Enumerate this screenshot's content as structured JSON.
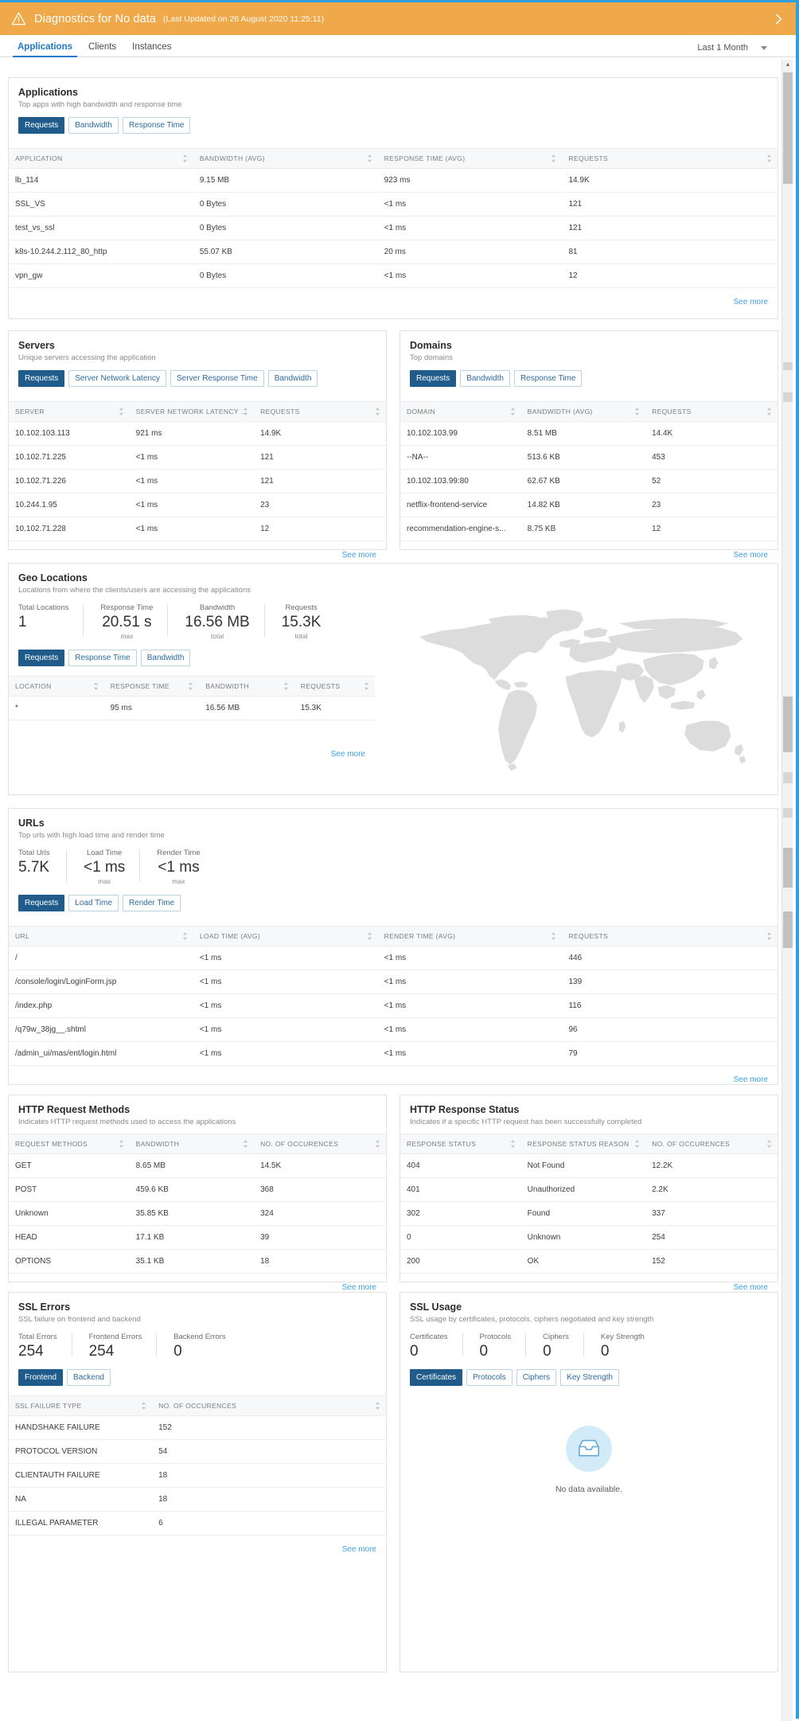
{
  "theme": {
    "banner_bg": "#efa94a",
    "accent_blue": "#2079c6",
    "pill_active_bg": "#1f5c8b",
    "link_blue": "#3da1e5",
    "frame_blue": "#2ca0e0"
  },
  "banner": {
    "icon": "warning-triangle-icon",
    "title": "Diagnostics for No data",
    "subtitle": "(Last Updated on 26 August 2020 11:25:11)",
    "chevron": "chevron-right-icon"
  },
  "tabs": [
    {
      "label": "Applications",
      "active": true
    },
    {
      "label": "Clients",
      "active": false
    },
    {
      "label": "Instances",
      "active": false
    }
  ],
  "time_range": {
    "label": "Last 1 Month",
    "icon": "chevron-down-icon"
  },
  "common": {
    "see_more": "See more"
  },
  "applications": {
    "title": "Applications",
    "subtitle": "Top apps with high bandwidth and response time",
    "pills": [
      "Requests",
      "Bandwidth",
      "Response Time"
    ],
    "active_pill": "Requests",
    "columns": [
      "APPLICATION",
      "BANDWIDTH (AVG)",
      "RESPONSE TIME (AVG)",
      "REQUESTS"
    ],
    "rows": [
      [
        "lb_114",
        "9.15 MB",
        "923 ms",
        "14.9K"
      ],
      [
        "SSL_VS",
        "0 Bytes",
        "<1 ms",
        "121"
      ],
      [
        "test_vs_ssl",
        "0 Bytes",
        "<1 ms",
        "121"
      ],
      [
        "k8s-10.244.2.112_80_http",
        "55.07 KB",
        "20 ms",
        "81"
      ],
      [
        "vpn_gw",
        "0 Bytes",
        "<1 ms",
        "12"
      ]
    ]
  },
  "servers": {
    "title": "Servers",
    "subtitle": "Unique servers accessing the application",
    "pills": [
      "Requests",
      "Server Network Latency",
      "Server Response Time",
      "Bandwidth"
    ],
    "active_pill": "Requests",
    "columns": [
      "SERVER",
      "SERVER NETWORK LATENCY (...",
      "REQUESTS"
    ],
    "rows": [
      [
        "10.102.103.113",
        "921 ms",
        "14.9K"
      ],
      [
        "10.102.71.225",
        "<1 ms",
        "121"
      ],
      [
        "10.102.71.226",
        "<1 ms",
        "121"
      ],
      [
        "10.244.1.95",
        "<1 ms",
        "23"
      ],
      [
        "10.102.71.228",
        "<1 ms",
        "12"
      ]
    ]
  },
  "domains": {
    "title": "Domains",
    "subtitle": "Top domains",
    "pills": [
      "Requests",
      "Bandwidth",
      "Response Time"
    ],
    "active_pill": "Requests",
    "columns": [
      "DOMAIN",
      "BANDWIDTH (AVG)",
      "REQUESTS"
    ],
    "rows": [
      [
        "10.102.103.99",
        "8.51 MB",
        "14.4K"
      ],
      [
        "--NA--",
        "513.6 KB",
        "453"
      ],
      [
        "10.102.103.99:80",
        "62.67 KB",
        "52"
      ],
      [
        "netflix-frontend-service",
        "14.82 KB",
        "23"
      ],
      [
        "recommendation-engine-s...",
        "8.75 KB",
        "12"
      ]
    ]
  },
  "geo": {
    "title": "Geo Locations",
    "subtitle": "Locations from where the clients/users are accessing the applications",
    "kpis": [
      {
        "label": "Total Locations",
        "value": "1",
        "unit": ""
      },
      {
        "label": "Response Time",
        "value": "20.51 s",
        "unit": "max"
      },
      {
        "label": "Bandwidth",
        "value": "16.56 MB",
        "unit": "total"
      },
      {
        "label": "Requests",
        "value": "15.3K",
        "unit": "total"
      }
    ],
    "pills": [
      "Requests",
      "Response Time",
      "Bandwidth"
    ],
    "active_pill": "Requests",
    "columns": [
      "LOCATION",
      "RESPONSE TIME",
      "BANDWIDTH",
      "REQUESTS"
    ],
    "rows": [
      [
        "*",
        "95 ms",
        "16.56 MB",
        "15.3K"
      ]
    ],
    "map_icon": "world-map"
  },
  "urls": {
    "title": "URLs",
    "subtitle": "Top urls with high load time and render time",
    "kpis": [
      {
        "label": "Total Urls",
        "value": "5.7K",
        "unit": ""
      },
      {
        "label": "Load Time",
        "value": "<1 ms",
        "unit": "max"
      },
      {
        "label": "Render Time",
        "value": "<1 ms",
        "unit": "max"
      }
    ],
    "pills": [
      "Requests",
      "Load Time",
      "Render Time"
    ],
    "active_pill": "Requests",
    "columns": [
      "URL",
      "LOAD TIME (AVG)",
      "RENDER TIME (AVG)",
      "REQUESTS"
    ],
    "rows": [
      [
        "/",
        "<1 ms",
        "<1 ms",
        "446"
      ],
      [
        "/console/login/LoginForm.jsp",
        "<1 ms",
        "<1 ms",
        "139"
      ],
      [
        "/index.php",
        "<1 ms",
        "<1 ms",
        "116"
      ],
      [
        "/q79w_38jg__.shtml",
        "<1 ms",
        "<1 ms",
        "96"
      ],
      [
        "/admin_ui/mas/ent/login.html",
        "<1 ms",
        "<1 ms",
        "79"
      ]
    ]
  },
  "http_methods": {
    "title": "HTTP Request Methods",
    "subtitle": "Indicates HTTP request methods used to access the applications",
    "columns": [
      "REQUEST METHODS",
      "BANDWIDTH",
      "NO. OF OCCURENCES"
    ],
    "rows": [
      [
        "GET",
        "8.65 MB",
        "14.5K"
      ],
      [
        "POST",
        "459.6 KB",
        "368"
      ],
      [
        "Unknown",
        "35.85 KB",
        "324"
      ],
      [
        "HEAD",
        "17.1 KB",
        "39"
      ],
      [
        "OPTIONS",
        "35.1 KB",
        "18"
      ]
    ]
  },
  "http_status": {
    "title": "HTTP Response Status",
    "subtitle": "Indicates if a specific HTTP request has been successfully completed",
    "columns": [
      "RESPONSE STATUS",
      "RESPONSE STATUS REASON",
      "NO. OF OCCURENCES"
    ],
    "rows": [
      [
        "404",
        "Not Found",
        "12.2K"
      ],
      [
        "401",
        "Unauthorized",
        "2.2K"
      ],
      [
        "302",
        "Found",
        "337"
      ],
      [
        "0",
        "Unknown",
        "254"
      ],
      [
        "200",
        "OK",
        "152"
      ]
    ]
  },
  "ssl_errors": {
    "title": "SSL Errors",
    "subtitle": "SSL failure on frontend and backend",
    "kpis": [
      {
        "label": "Total Errors",
        "value": "254",
        "unit": ""
      },
      {
        "label": "Frontend Errors",
        "value": "254",
        "unit": ""
      },
      {
        "label": "Backend Errors",
        "value": "0",
        "unit": ""
      }
    ],
    "pills": [
      "Frontend",
      "Backend"
    ],
    "active_pill": "Frontend",
    "columns": [
      "SSL FAILURE TYPE",
      "NO. OF OCCURENCES"
    ],
    "rows": [
      [
        "HANDSHAKE FAILURE",
        "152"
      ],
      [
        "PROTOCOL VERSION",
        "54"
      ],
      [
        "CLIENTAUTH FAILURE",
        "18"
      ],
      [
        "NA",
        "18"
      ],
      [
        "ILLEGAL PARAMETER",
        "6"
      ]
    ]
  },
  "ssl_usage": {
    "title": "SSL Usage",
    "subtitle": "SSL usage by certificates, protocols, ciphers negotiated and key strength",
    "kpis": [
      {
        "label": "Certificates",
        "value": "0",
        "unit": ""
      },
      {
        "label": "Protocols",
        "value": "0",
        "unit": ""
      },
      {
        "label": "Ciphers",
        "value": "0",
        "unit": ""
      },
      {
        "label": "Key Strength",
        "value": "0",
        "unit": ""
      }
    ],
    "pills": [
      "Certificates",
      "Protocols",
      "Ciphers",
      "Key Strength"
    ],
    "active_pill": "Certificates",
    "empty": {
      "icon": "inbox-empty-icon",
      "text": "No data available."
    }
  }
}
